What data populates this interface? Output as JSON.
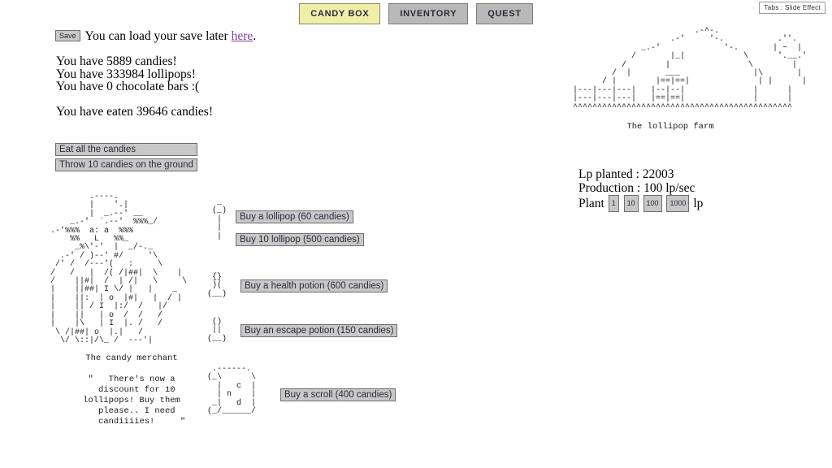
{
  "window": {
    "title": "Candy Box"
  },
  "tabs": [
    {
      "label": "CANDY BOX",
      "selected": true
    },
    {
      "label": "INVENTORY",
      "selected": false
    },
    {
      "label": "QUEST",
      "selected": false
    }
  ],
  "slide_effect": {
    "label": "Tabs : Slide Effect"
  },
  "save": {
    "button_label": "Save",
    "text_before": "You can load your save later ",
    "link_label": "here",
    "text_after": "."
  },
  "counters": {
    "candies": "You have 5889 candies!",
    "lollipops": "You have 333984 lollipops!",
    "chocolate": "You have 0 chocolate bars :(",
    "eaten": "You have eaten 39646 candies!"
  },
  "main_actions": {
    "eat_all": "Eat all the candies",
    "throw": "Throw 10 candies on the ground"
  },
  "merchant": {
    "title": "The candy merchant",
    "speech": "\"   There's now a\n  discount for 10\nlollipops! Buy them\n  please.. I need\n    candiiiies!     \"",
    "art": "        .----.\n        |    '.|\n        |  _.--' __\n    _.-'  `.--'  %%%_/\n.-'%%%  a: a  %%%\n    %%   L   %%_\n     _%\\'-'  |  _/-._\n  .-' / )--' #/     '\\\n /' /  /---'(   :     \\\n/   /   |  /( /|##|  \\    |\n/    ||#|  /  | /|   \\     \\\n|    ||##| I \\/ |   |    _\n|    ||:  | o  |#|   |  / |\n|    || / I  |:/  /   |/\n|    ||   | o  /  /   /\n|    |\\   | I  |. /   /\n \\ /|##| o  |.|   /\n  \\/ \\::|/\\_ /  ---'|"
  },
  "shop": {
    "items": [
      {
        "name": "lollipop",
        "art": "  _\n (_)\n  |\n  |\n  |",
        "button_label": "Buy a lollipop (60 candies)"
      },
      {
        "name": "lollipop-10",
        "art": "",
        "button_label": "Buy 10 lollipop (500 candies)"
      },
      {
        "name": "health-potion",
        "art": " {}\n )(\n(__)",
        "button_label": "Buy a health potion (600 candies)"
      },
      {
        "name": "escape-potion",
        "art": " ()\n ||\n(__)",
        "button_label": "Buy an escape potion (150 candies)"
      },
      {
        "name": "scroll",
        "art": " .------.\n(_\\      \\\n  |   c  |\n  | n    |\n _|   d  |\n(_/______/",
        "button_label": "Buy a scroll (400 candies)"
      }
    ]
  },
  "farm": {
    "art": "                         .-^-.\n                    .-'     '-.           .''.\n              _.-'             '-.       | ~  |\n            /       |_|            \\      '.__.'\n          /        |                \\        |\n        /  |       ___               |\\       |\n      / |        |==|==|              | |      |\n|---|---|---|   |--|--|              |      |\n|---|---|---|   |==|==|              |      |\n^^^^^^^^^^^^^^^^^^^^^^^^^^^^^^^^^^^^^^^^^^^^^",
    "title": "The lollipop farm",
    "lp_planted": "Lp planted : 22003",
    "production": "Production : 100 lp/sec",
    "plant_label": "Plant",
    "plant_buttons": [
      "1",
      "10",
      "100",
      "1000"
    ],
    "plant_unit": "lp"
  },
  "colors": {
    "tab_selected_bg": "#f0efa8",
    "tab_bg": "#b9b9b9",
    "button_bg": "#c8c8c8",
    "link": "#7b3f9d",
    "text": "#000000"
  }
}
